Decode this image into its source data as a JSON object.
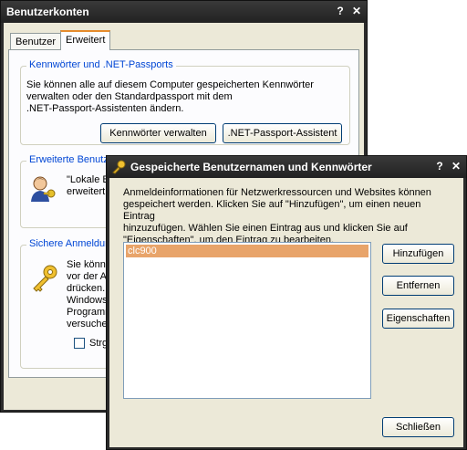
{
  "main_window": {
    "title": "Benutzerkonten",
    "help": "?",
    "close": "✕",
    "tabs": [
      {
        "label": "Benutzer"
      },
      {
        "label": "Erweitert"
      }
    ],
    "passwords_group": {
      "title": "Kennwörter und .NET-Passports",
      "text_lines": [
        "Sie können alle auf diesem Computer gespeicherten Kennwörter",
        "verwalten oder den Standardpassport mit dem",
        ".NET-Passport-Assistenten ändern."
      ],
      "manage_button": "Kennwörter verwalten",
      "passport_button": ".NET-Passport-Assistent"
    },
    "advanced_group": {
      "title": "Erweiterte Benutz",
      "text_lines": [
        "\"Lokale Be",
        "erweitert"
      ]
    },
    "secure_group": {
      "title": "Sichere Anmeldun",
      "text_lines": [
        "Sie könne",
        "vor der A",
        "drücken.",
        "Windows",
        "Programm",
        "versuche"
      ],
      "checkbox_label": "Strg+"
    }
  },
  "dialog": {
    "title": "Gespeicherte Benutzernamen und Kennwörter",
    "help": "?",
    "close": "✕",
    "description_lines": [
      "Anmeldeinformationen für Netzwerkressourcen und Websites können",
      "gespeichert werden. Klicken Sie auf \"Hinzufügen\", um einen neuen Eintrag",
      "hinzuzufügen. Wählen Sie einen Eintrag aus und klicken Sie auf",
      "\"Eigenschaften\", um den Eintrag zu bearbeiten."
    ],
    "list_items": [
      "clc900"
    ],
    "add_button": "Hinzufügen",
    "remove_button": "Entfernen",
    "properties_button": "Eigenschaften",
    "close_button": "Schließen"
  },
  "icons": {
    "user_icon": "user-key-icon",
    "key_icon": "key-icon",
    "title_key_icon": "title-key-icon"
  }
}
